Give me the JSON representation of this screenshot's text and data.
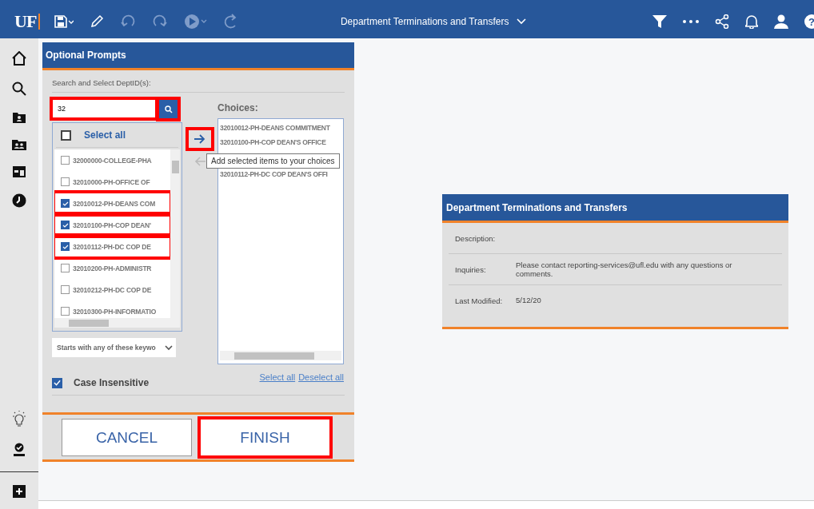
{
  "topbar": {
    "logo": "UF",
    "title": "Department Terminations and Transfers",
    "help": "?"
  },
  "prompts": {
    "title": "Optional Prompts",
    "section_label": "Search and Select DeptID(s):",
    "search": {
      "value": "32",
      "highlighted": true
    },
    "search_button": {
      "highlighted": true
    },
    "select_all": {
      "label": "Select all",
      "checked": false
    },
    "options": [
      {
        "label": "32000000-COLLEGE-PHA",
        "checked": false,
        "highlighted": false
      },
      {
        "label": "32010000-PH-OFFICE OF",
        "checked": false,
        "highlighted": false
      },
      {
        "label": "32010012-PH-DEANS COM",
        "checked": true,
        "highlighted": true
      },
      {
        "label": "32010100-PH-COP DEAN'",
        "checked": true,
        "highlighted": true
      },
      {
        "label": "32010112-PH-DC COP DE",
        "checked": true,
        "highlighted": true
      },
      {
        "label": "32010200-PH-ADMINISTR",
        "checked": false,
        "highlighted": false
      },
      {
        "label": "32010212-PH-DC COP DE",
        "checked": false,
        "highlighted": false
      },
      {
        "label": "32010300-PH-INFORMATIO",
        "checked": false,
        "highlighted": false
      }
    ],
    "match_mode": "Starts with any of these keywo",
    "case_insensitive": {
      "label": "Case Insensitive",
      "checked": true
    },
    "add_button": {
      "highlighted": true
    },
    "tooltip": "Add selected items to your choices",
    "choices_label": "Choices:",
    "choices": [
      "32010012-PH-DEANS COMMITMENT",
      "32010100-PH-COP DEAN'S OFFICE",
      "32010112-PH-DC COP DEAN'S OFFI"
    ],
    "select_all_link": "Select all",
    "deselect_all_link": "Deselect all",
    "buttons": [
      {
        "label": "CANCEL",
        "highlighted": false
      },
      {
        "label": "FINISH",
        "highlighted": true
      }
    ]
  },
  "info": {
    "title": "Department Terminations and Transfers",
    "rows": [
      {
        "label": "Description:"
      },
      {
        "label": "Inquiries:",
        "value": "Please contact reporting-services@ufl.edu with any questions or comments."
      },
      {
        "label": "Last Modified:",
        "value": "5/12/20"
      }
    ]
  }
}
